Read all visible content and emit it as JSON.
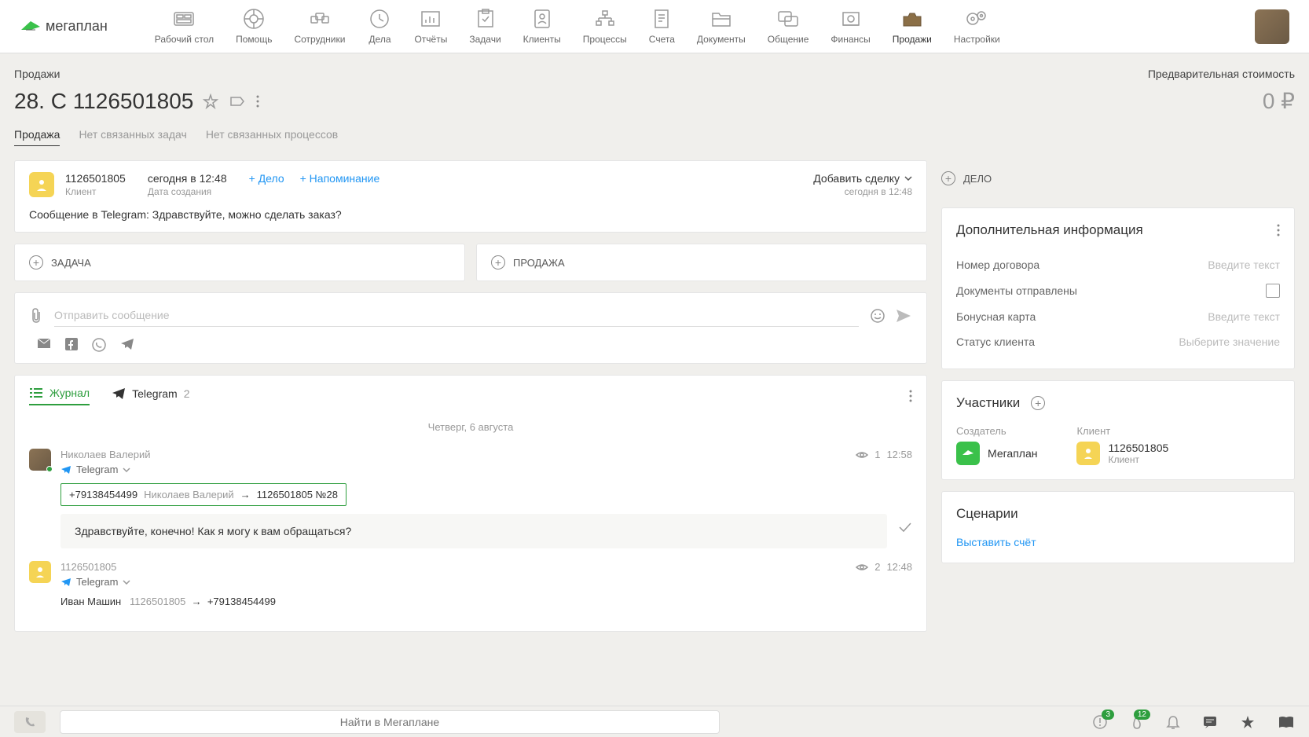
{
  "logo": "мегаплан",
  "nav": [
    {
      "label": "Рабочий стол"
    },
    {
      "label": "Помощь"
    },
    {
      "label": "Сотрудники"
    },
    {
      "label": "Дела"
    },
    {
      "label": "Отчёты"
    },
    {
      "label": "Задачи"
    },
    {
      "label": "Клиенты"
    },
    {
      "label": "Процессы"
    },
    {
      "label": "Счета"
    },
    {
      "label": "Документы"
    },
    {
      "label": "Общение"
    },
    {
      "label": "Финансы"
    },
    {
      "label": "Продажи"
    },
    {
      "label": "Настройки"
    }
  ],
  "breadcrumb": "Продажи",
  "cost_label": "Предварительная стоимость",
  "title": "28. С 1126501805",
  "price": "0 ₽",
  "tabs": [
    {
      "label": "Продажа"
    },
    {
      "label": "Нет связанных задач"
    },
    {
      "label": "Нет связанных процессов"
    }
  ],
  "client": {
    "id": "1126501805",
    "role": "Клиент",
    "created": "сегодня в 12:48",
    "created_label": "Дата создания",
    "actions": {
      "delo": "+ Дело",
      "reminder": "+ Напоминание"
    },
    "deal_add": "Добавить сделку",
    "deal_time": "сегодня в 12:48",
    "message": "Сообщение в Telegram: Здравствуйте, можно сделать заказ?"
  },
  "btns": {
    "task": "ЗАДАЧА",
    "sale": "ПРОДАЖА"
  },
  "compose": {
    "placeholder": "Отправить сообщение"
  },
  "feed": {
    "tabs": {
      "journal": "Журнал",
      "telegram": "Telegram",
      "tg_count": "2"
    },
    "date": "Четверг, 6 августа",
    "entry1": {
      "name": "Николаев Валерий",
      "channel": "Telegram",
      "views": "1",
      "time": "12:58",
      "phone": "+79138454499",
      "person": "Николаев Валерий",
      "to": "1126501805 №28",
      "msg": "Здравствуйте, конечно! Как я могу к вам обращаться?"
    },
    "entry2": {
      "name": "1126501805",
      "channel": "Telegram",
      "views": "2",
      "time": "12:48",
      "person": "Иван Машин",
      "id": "1126501805",
      "phone": "+79138454499"
    }
  },
  "side": {
    "delo": "ДЕЛО",
    "info": {
      "title": "Дополнительная информация",
      "rows": {
        "contract": {
          "label": "Номер договора",
          "ph": "Введите текст"
        },
        "docs": {
          "label": "Документы отправлены"
        },
        "bonus": {
          "label": "Бонусная карта",
          "ph": "Введите текст"
        },
        "status": {
          "label": "Статус клиента",
          "ph": "Выберите значение"
        }
      }
    },
    "participants": {
      "title": "Участники",
      "creator_label": "Создатель",
      "creator": "Мегаплан",
      "client_label": "Клиент",
      "client": "1126501805",
      "client_role": "Клиент"
    },
    "scenarios": {
      "title": "Сценарии",
      "action": "Выставить счёт"
    }
  },
  "bottom": {
    "search": "Найти в Мегаплане",
    "badge1": "3",
    "badge2": "12"
  }
}
